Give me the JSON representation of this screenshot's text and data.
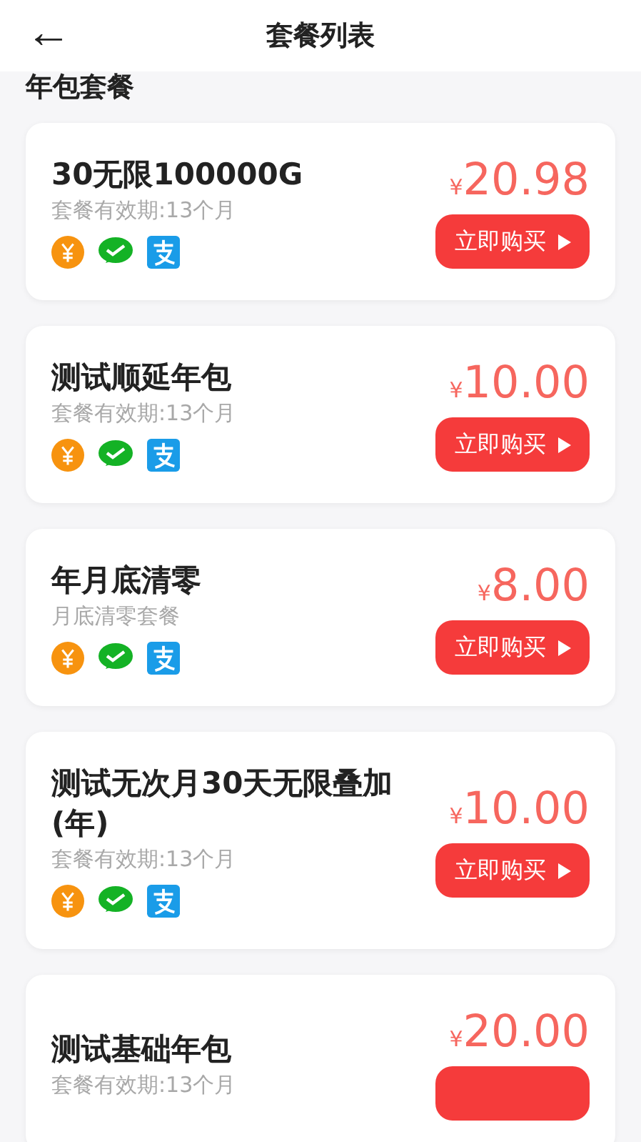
{
  "header": {
    "back": "←",
    "title": "套餐列表"
  },
  "section": {
    "title": "年包套餐"
  },
  "plans": [
    {
      "name": "30无限100000G",
      "note": "套餐有效期:13个月",
      "currency": "¥",
      "price": "20.98",
      "payments": [
        {
          "kind": "coin"
        },
        {
          "kind": "wechat"
        },
        {
          "kind": "alipay"
        }
      ],
      "buy": "立即购买"
    },
    {
      "name": "测试顺延年包",
      "note": "套餐有效期:13个月",
      "currency": "¥",
      "price": "10.00",
      "payments": [
        {
          "kind": "coin"
        },
        {
          "kind": "wechat"
        },
        {
          "kind": "alipay"
        }
      ],
      "buy": "立即购买"
    },
    {
      "name": "年月底清零",
      "note": "月底清零套餐",
      "currency": "¥",
      "price": "8.00",
      "payments": [
        {
          "kind": "coin"
        },
        {
          "kind": "wechat"
        },
        {
          "kind": "alipay"
        }
      ],
      "buy": "立即购买"
    },
    {
      "name": "测试无次月30天无限叠加(年)",
      "note": "套餐有效期:13个月",
      "currency": "¥",
      "price": "10.00",
      "payments": [
        {
          "kind": "coin"
        },
        {
          "kind": "wechat"
        },
        {
          "kind": "alipay"
        }
      ],
      "buy": "立即购买"
    },
    {
      "name": "测试基础年包",
      "note": "套餐有效期:13个月",
      "currency": "¥",
      "price": "20.00"
    }
  ]
}
